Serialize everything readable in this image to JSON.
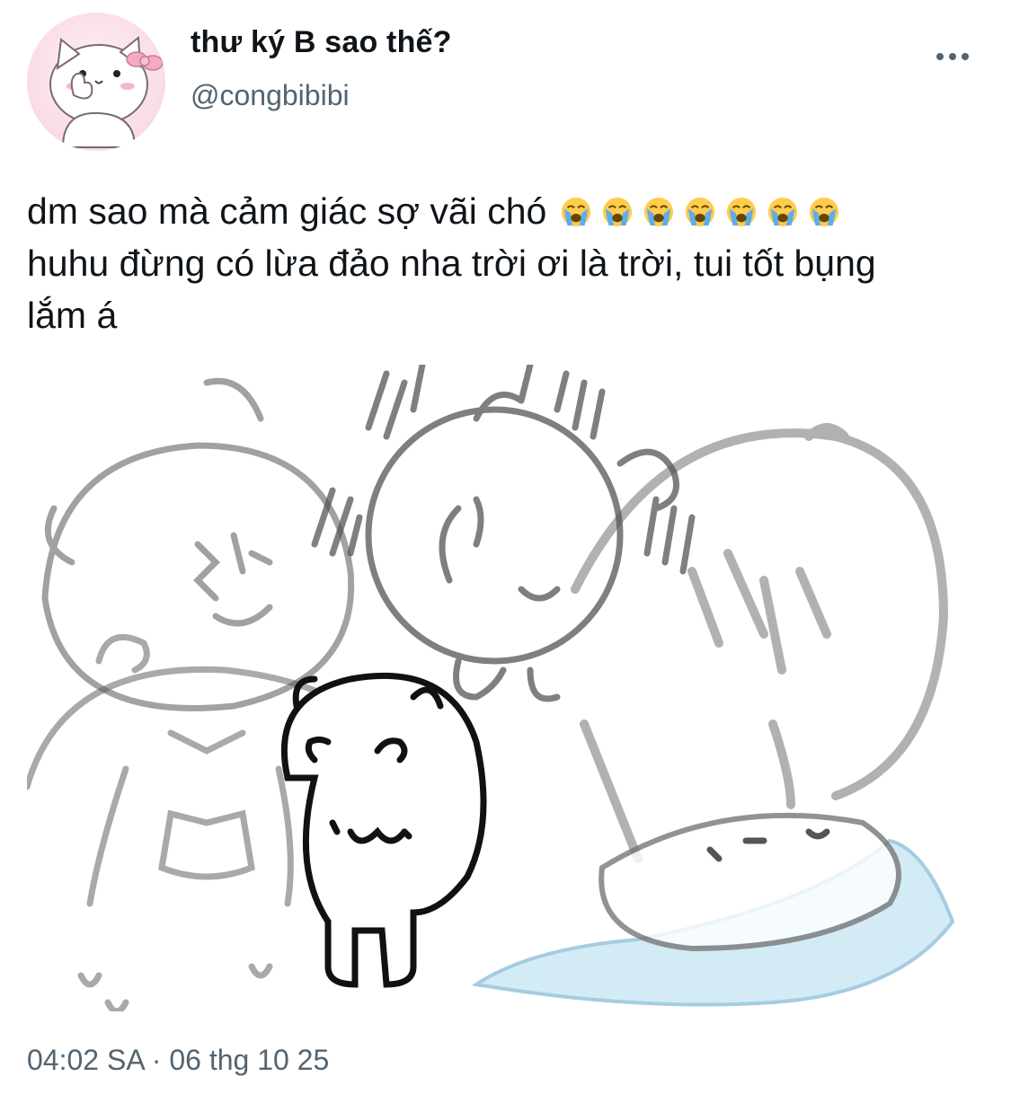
{
  "tweet": {
    "display_name": "thư ký B sao thế?",
    "handle": "@congbibibi",
    "text_lines": [
      "dm sao mà cảm giác sợ vãi chó",
      "huhu đừng có lừa đảo nha trời ơi là trời, tui tốt bụng",
      "lắm á"
    ],
    "emoji": [
      "loudly-crying-face",
      "loudly-crying-face",
      "loudly-crying-face",
      "loudly-crying-face",
      "loudly-crying-face",
      "loudly-crying-face",
      "loudly-crying-face"
    ],
    "timestamp": "04:02 SA · 06 thg 10 25",
    "media": {
      "type": "image",
      "subject": "cartoon-meme-image"
    },
    "avatar": {
      "type": "image",
      "subject": "avatar-image"
    }
  },
  "icons": {
    "more": "more-horizontal-icon"
  },
  "colors": {
    "text_primary": "#0f1419",
    "text_secondary": "#536471",
    "avatar_bg": "#f9dbe6",
    "emoji_face": "#ffcc4d",
    "emoji_tears": "#5dadec"
  }
}
